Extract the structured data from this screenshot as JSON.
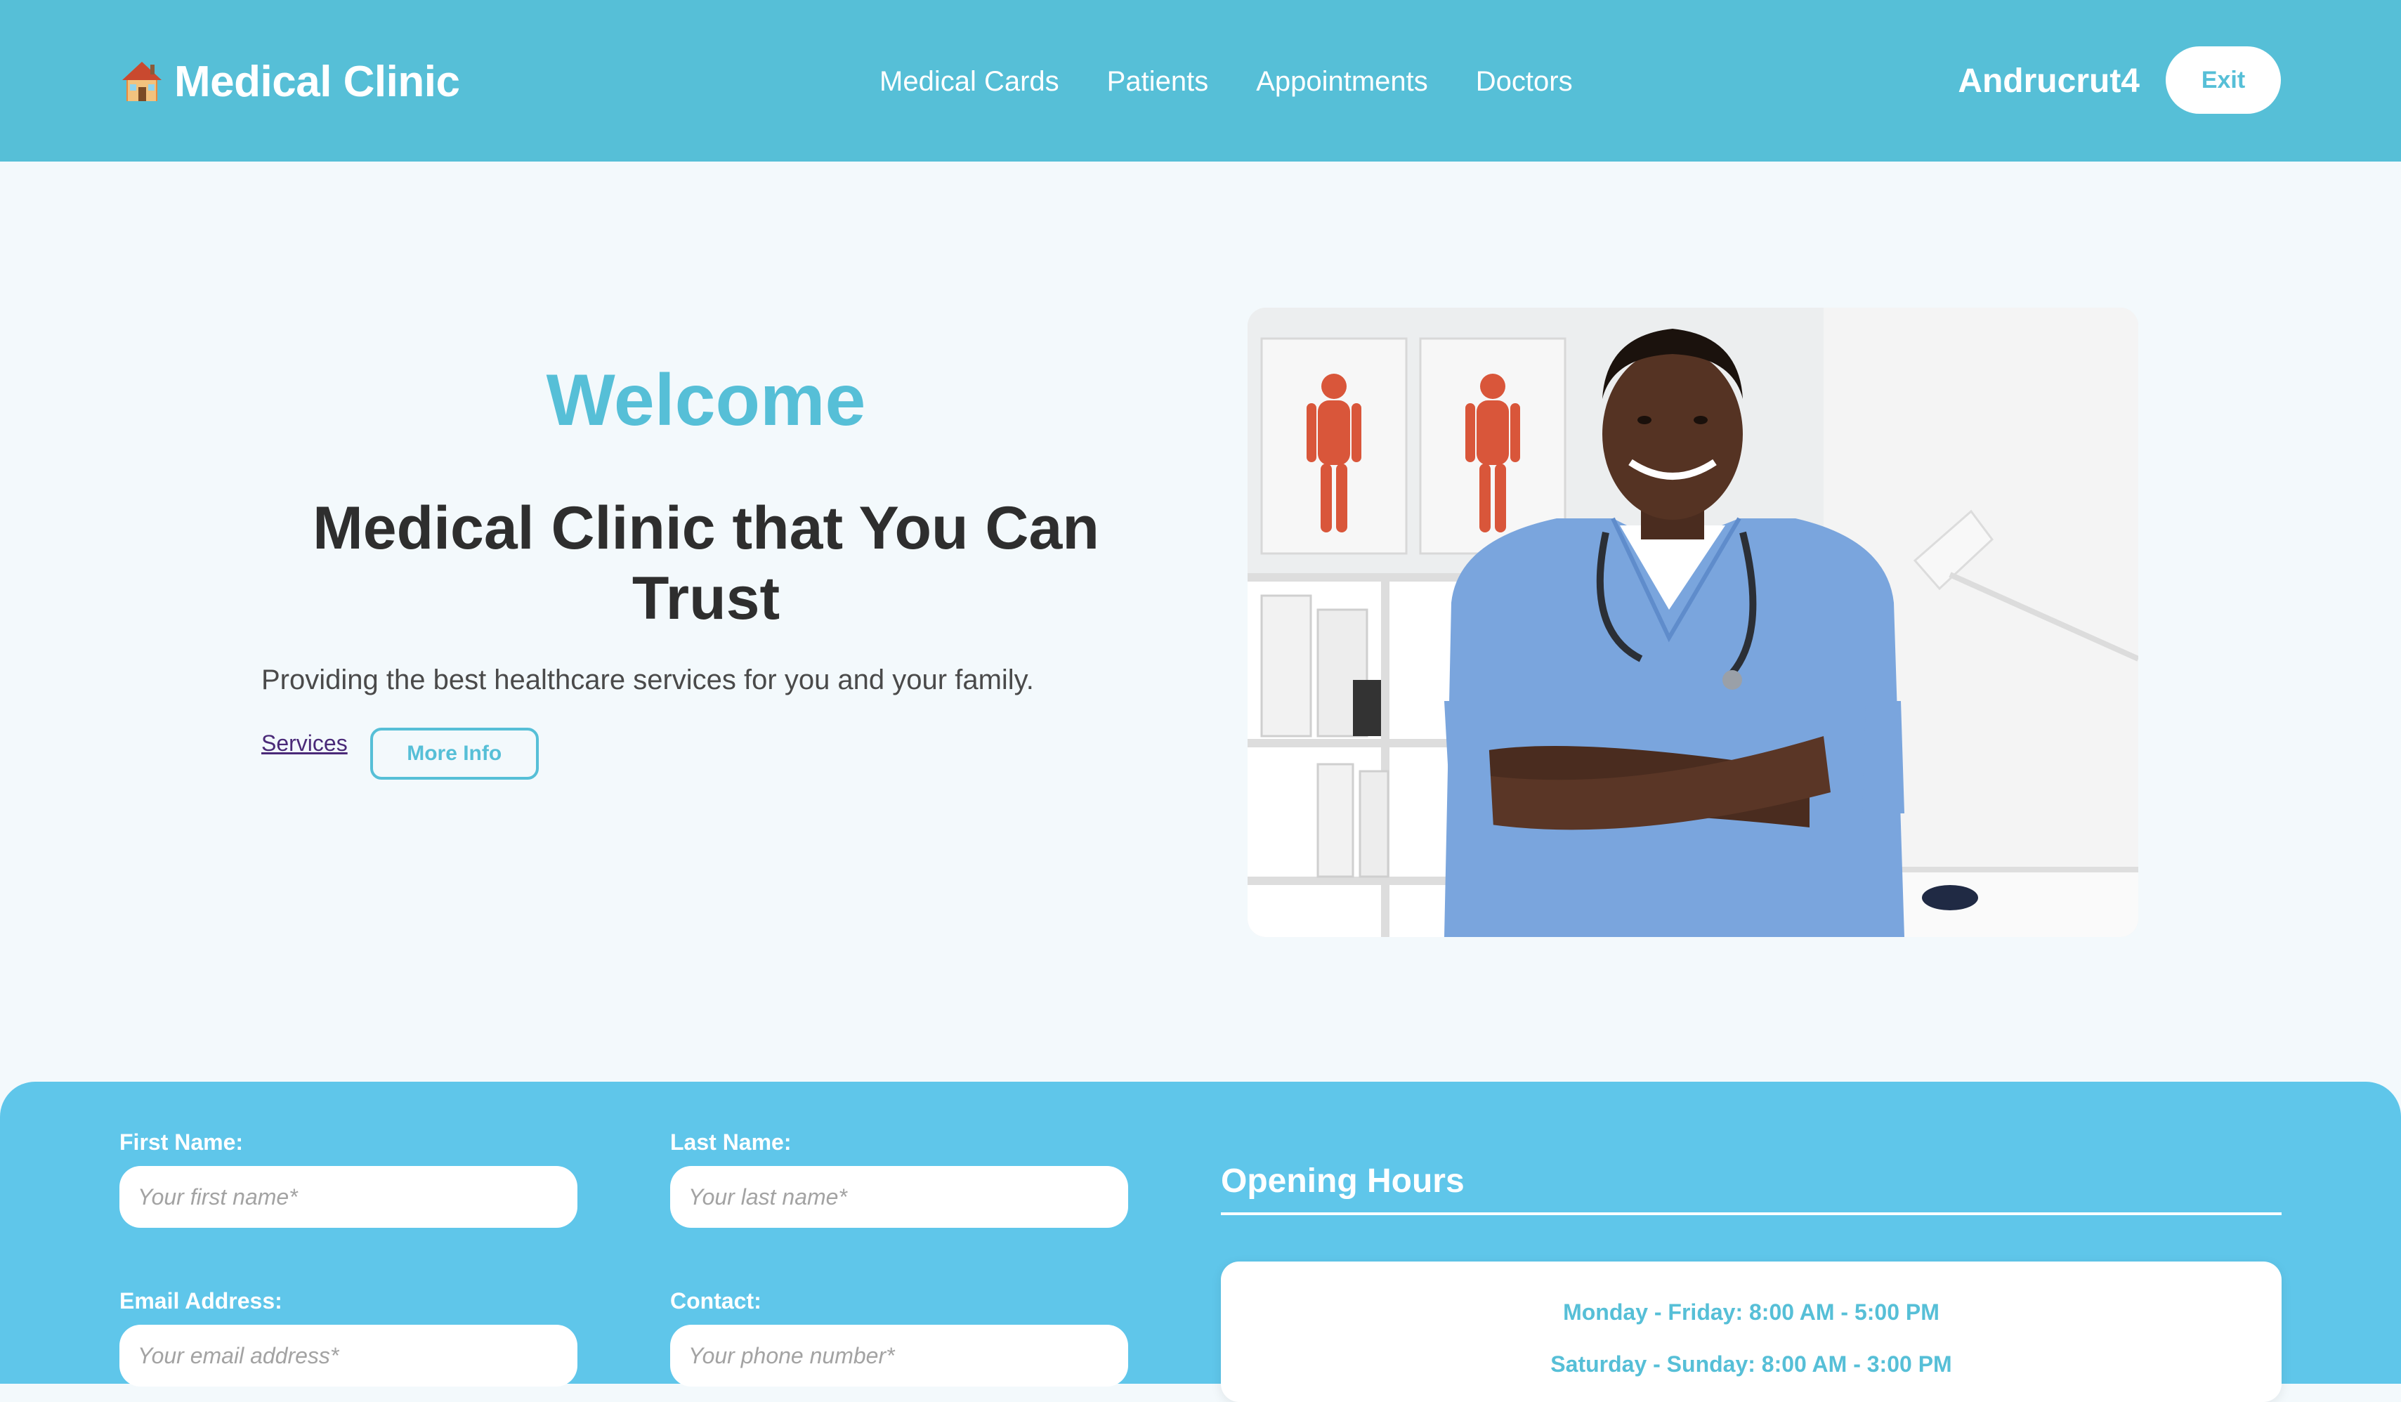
{
  "brand": {
    "icon": "house-icon",
    "name": "Medical Clinic"
  },
  "nav": {
    "items": [
      {
        "label": "Medical Cards"
      },
      {
        "label": "Patients"
      },
      {
        "label": "Appointments"
      },
      {
        "label": "Doctors"
      }
    ]
  },
  "user": {
    "name": "Andrucrut4",
    "exit_label": "Exit"
  },
  "hero": {
    "welcome": "Welcome",
    "headline": "Medical Clinic that You Can Trust",
    "tagline": "Providing the best healthcare services for you and your family.",
    "services_link": "Services",
    "more_info_label": "More Info",
    "image": "smiling-doctor-photo"
  },
  "form": {
    "first_name": {
      "label": "First Name:",
      "placeholder": "Your first name*"
    },
    "last_name": {
      "label": "Last Name:",
      "placeholder": "Your last name*"
    },
    "email": {
      "label": "Email Address:",
      "placeholder": "Your email address*"
    },
    "contact": {
      "label": "Contact:",
      "placeholder": "Your phone number*"
    }
  },
  "hours": {
    "title": "Opening Hours",
    "weekdays": "Monday - Friday: 8:00 AM - 5:00 PM",
    "weekend": "Saturday - Sunday: 8:00 AM - 3:00 PM"
  },
  "colors": {
    "header": "#56bfd7",
    "accent": "#56bfd7",
    "panel": "#5fc6ea",
    "page_background": "#f3f9fc",
    "headline": "#2e2e2e",
    "link": "#4a2a78"
  }
}
